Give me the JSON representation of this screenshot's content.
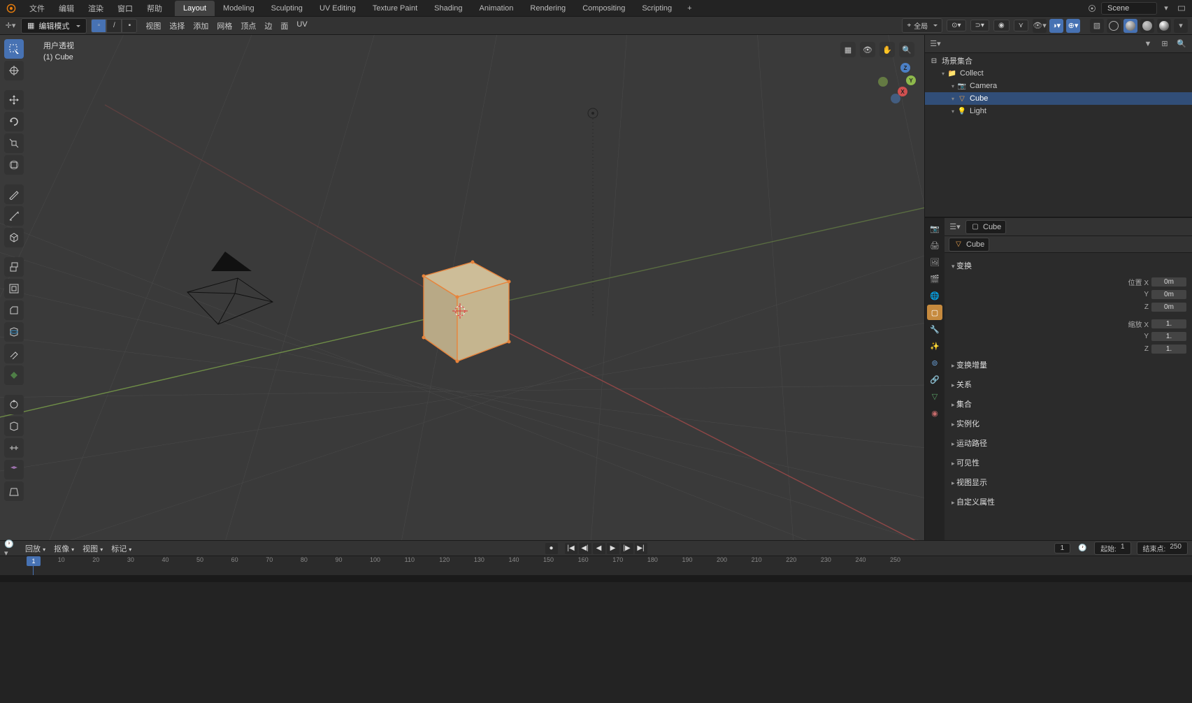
{
  "top_menu": [
    "文件",
    "编辑",
    "渲染",
    "窗口",
    "帮助"
  ],
  "workspaces": [
    "Layout",
    "Modeling",
    "Sculpting",
    "UV Editing",
    "Texture Paint",
    "Shading",
    "Animation",
    "Rendering",
    "Compositing",
    "Scripting"
  ],
  "active_workspace": "Layout",
  "scene_label": "Scene",
  "header2": {
    "mode": "编辑模式",
    "menus": [
      "视图",
      "选择",
      "添加",
      "网格",
      "顶点",
      "边",
      "面",
      "UV"
    ],
    "orient_label": "全局"
  },
  "overlay": {
    "line1": "用户透视",
    "line2": "(1) Cube"
  },
  "outliner": {
    "title": "场景集合",
    "rows": [
      {
        "label": "Collect",
        "icon": "collection",
        "indent": 1,
        "sel": false
      },
      {
        "label": "Camera",
        "icon": "camera",
        "indent": 2,
        "sel": false
      },
      {
        "label": "Cube",
        "icon": "mesh",
        "indent": 2,
        "sel": true
      },
      {
        "label": "Light",
        "icon": "light",
        "indent": 2,
        "sel": false
      }
    ]
  },
  "properties": {
    "crumb1": "Cube",
    "crumb2": "Cube",
    "panel_transform": "变换",
    "transform": {
      "pos_label": "位置 X",
      "pos_x": "0m",
      "pos_y": "0m",
      "pos_z": "0m",
      "scale_label": "缩放 X",
      "scale_x": "1.",
      "scale_y": "1.",
      "scale_z": "1."
    },
    "collapsed_panels": [
      "变换增量",
      "关系",
      "集合",
      "实例化",
      "运动路径",
      "可见性",
      "视图显示",
      "自定义属性"
    ]
  },
  "timeline": {
    "menus": [
      "回放",
      "抠像",
      "视图",
      "标记"
    ],
    "current": "1",
    "start_label": "起始:",
    "start": "1",
    "end_label": "结束点:",
    "end": "250",
    "ticks": [
      1,
      10,
      20,
      30,
      40,
      50,
      60,
      70,
      80,
      90,
      100,
      110,
      120,
      130,
      140,
      150,
      160,
      170,
      180,
      190,
      200,
      210,
      220,
      230,
      240,
      250
    ]
  }
}
